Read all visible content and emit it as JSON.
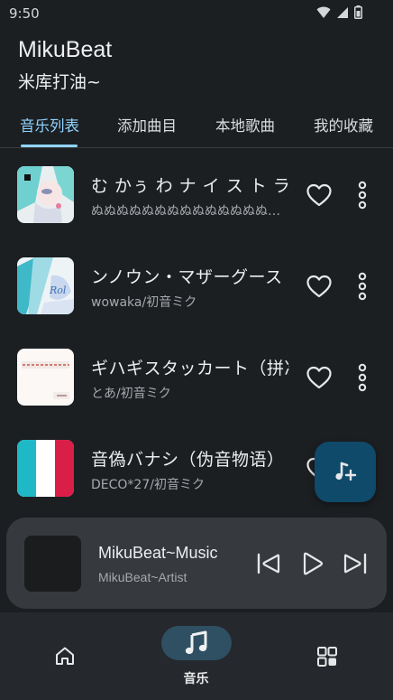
{
  "status_bar": {
    "time": "9:50"
  },
  "header": {
    "title": "MikuBeat",
    "subtitle": "米库打油~"
  },
  "tabs": [
    {
      "label": "音乐列表",
      "active": true
    },
    {
      "label": "添加曲目",
      "active": false
    },
    {
      "label": "本地歌曲",
      "active": false
    },
    {
      "label": "我的收藏",
      "active": false
    }
  ],
  "songs": [
    {
      "title": "む かぅ わ ナ イ ス ト ラ ・",
      "artist": "ぬぬぬぬぬぬぬぬぬぬぬぬぬぬぬぬぬぬぬぬ"
    },
    {
      "title": "ンノウン・マザーグース",
      "artist": "wowaka/初音ミク"
    },
    {
      "title": "ギハギスタッカート（拼凑",
      "artist": "とあ/初音ミク"
    },
    {
      "title": "音偽バナシ（伪音物语）",
      "artist": "DECO*27/初音ミク"
    }
  ],
  "player": {
    "title": "MikuBeat~Music",
    "artist": "MikuBeat~Artist"
  },
  "bottom_nav": {
    "music_label": "音乐"
  },
  "colors": {
    "accent": "#8fd3ff",
    "background": "#1c1f22",
    "fab": "#0f4a6a",
    "player": "#36393d",
    "nav": "#25282c"
  }
}
